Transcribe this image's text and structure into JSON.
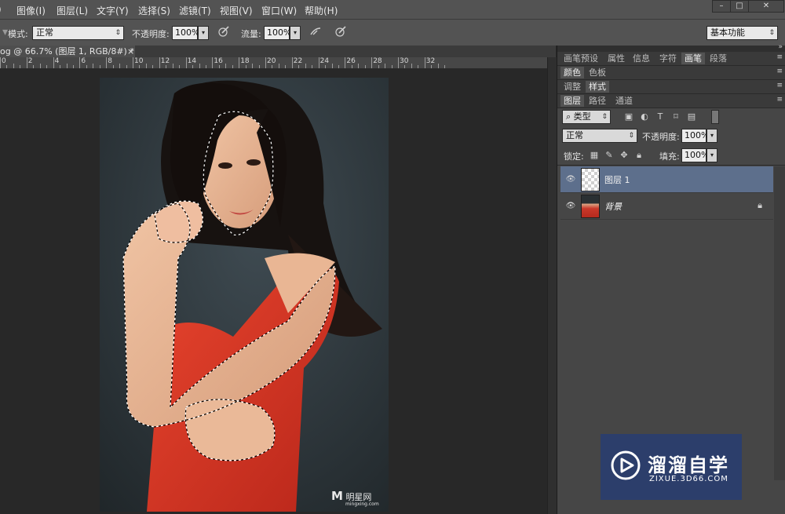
{
  "menu": {
    "items": [
      "图像(I)",
      "图层(L)",
      "文字(Y)",
      "选择(S)",
      "滤镜(T)",
      "视图(V)",
      "窗口(W)",
      "帮助(H)"
    ],
    "window_controls": [
      "–",
      "□",
      "✕"
    ]
  },
  "options": {
    "mode_label": "模式:",
    "mode_value": "正常",
    "opacity_label": "不透明度:",
    "opacity_value": "100%",
    "flow_label": "流量:",
    "flow_value": "100%",
    "workspace": "基本功能"
  },
  "document": {
    "tab_title": "og @ 66.7% (图层 1, RGB/8#) *",
    "close": "×"
  },
  "ruler": {
    "labels": [
      "0",
      "2",
      "4",
      "6",
      "8",
      "10",
      "12",
      "14",
      "16",
      "18",
      "20",
      "22",
      "24",
      "26",
      "28",
      "30",
      "32"
    ]
  },
  "panels": {
    "row1_tabs": [
      "画笔预设",
      "属性",
      "信息",
      "字符",
      "画笔",
      "段落"
    ],
    "row2_tabs": [
      "颜色",
      "色板"
    ],
    "row3_tabs": [
      "调整",
      "样式"
    ],
    "layers_tabs": [
      "图层",
      "路径",
      "通道"
    ],
    "filter_kind": "类型",
    "blend_mode": "正常",
    "opacity_label": "不透明度:",
    "opacity_value": "100%",
    "lock_label": "锁定:",
    "fill_label": "填充:",
    "fill_value": "100%",
    "layers": [
      {
        "name": "图层 1",
        "selected": true
      },
      {
        "name": "背景",
        "selected": false,
        "locked": true
      }
    ]
  },
  "watermark": {
    "title": "溜溜自学",
    "subtitle": "ZIXUE.3D66.COM"
  },
  "image_watermark": {
    "text": "明星网",
    "sub": "mingxing.com"
  },
  "colors": {
    "accent_selected_layer": "#5d6f8c",
    "watermark_bg": "#2c3e6b"
  }
}
